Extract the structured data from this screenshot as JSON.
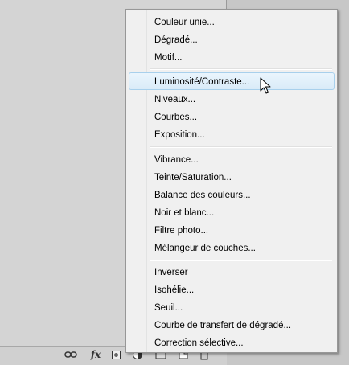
{
  "panel": {
    "bottom_icons": [
      "link-icon",
      "fx-icon",
      "mask-icon",
      "adjustment-layer-icon",
      "group-icon",
      "new-layer-icon",
      "trash-icon"
    ],
    "fx_label": "fx"
  },
  "menu": {
    "groups": [
      {
        "items": [
          {
            "label": "Couleur unie..."
          },
          {
            "label": "Dégradé..."
          },
          {
            "label": "Motif..."
          }
        ]
      },
      {
        "items": [
          {
            "label": "Luminosité/Contraste...",
            "hover": true
          },
          {
            "label": "Niveaux..."
          },
          {
            "label": "Courbes..."
          },
          {
            "label": "Exposition..."
          }
        ]
      },
      {
        "items": [
          {
            "label": "Vibrance..."
          },
          {
            "label": "Teinte/Saturation..."
          },
          {
            "label": "Balance des couleurs..."
          },
          {
            "label": "Noir et blanc..."
          },
          {
            "label": "Filtre photo..."
          },
          {
            "label": "Mélangeur de couches..."
          }
        ]
      },
      {
        "items": [
          {
            "label": "Inverser"
          },
          {
            "label": "Isohélie..."
          },
          {
            "label": "Seuil..."
          },
          {
            "label": "Courbe de transfert de dégradé..."
          },
          {
            "label": "Correction sélective..."
          }
        ]
      }
    ],
    "colors": {
      "hover_border": "#a8d0ec",
      "hover_fill": "#d9ebf8",
      "background": "#f0f0f0"
    }
  }
}
